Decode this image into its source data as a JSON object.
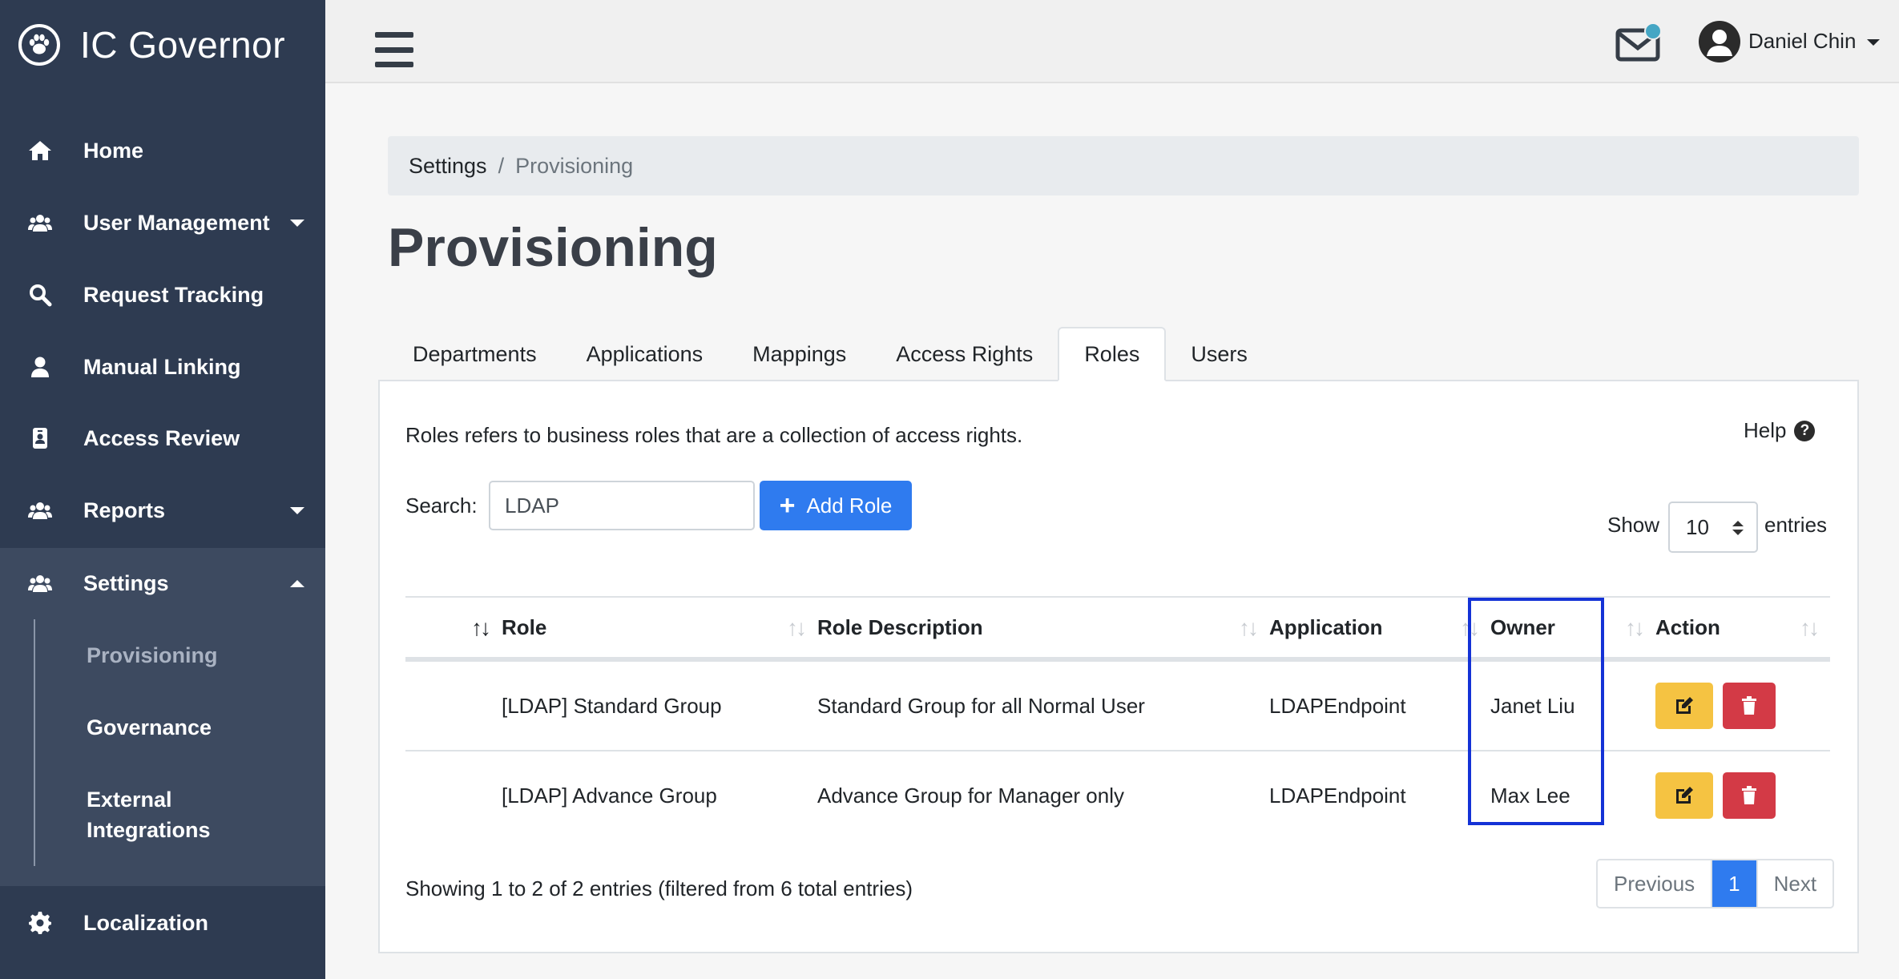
{
  "brand": {
    "name": "IC Governor",
    "logo_icon": "paw-icon"
  },
  "sidebar": {
    "items": [
      {
        "label": "Home",
        "icon": "home-icon"
      },
      {
        "label": "User Management",
        "icon": "users-icon",
        "has_caret": "down"
      },
      {
        "label": "Request Tracking",
        "icon": "search-icon"
      },
      {
        "label": "Manual Linking",
        "icon": "user-icon"
      },
      {
        "label": "Access Review",
        "icon": "id-badge-icon"
      },
      {
        "label": "Reports",
        "icon": "users-icon",
        "has_caret": "down"
      },
      {
        "label": "Settings",
        "icon": "users-icon",
        "has_caret": "up"
      },
      {
        "label": "Localization",
        "icon": "gear-icon"
      }
    ],
    "settings_sub": [
      {
        "label": "Provisioning",
        "active": true
      },
      {
        "label": "Governance"
      },
      {
        "label": "External Integrations"
      }
    ]
  },
  "topbar": {
    "user_name": "Daniel Chin",
    "mail_icon": "envelope-icon",
    "notification_color": "#45a6c4"
  },
  "breadcrumb": {
    "parent": "Settings",
    "separator": "/",
    "current": "Provisioning"
  },
  "page": {
    "title": "Provisioning"
  },
  "tabs": [
    "Departments",
    "Applications",
    "Mappings",
    "Access Rights",
    "Roles",
    "Users"
  ],
  "active_tab": "Roles",
  "panel": {
    "description": "Roles refers to business roles that are a collection of access rights.",
    "help_label": "Help",
    "search_label": "Search:",
    "search_value": "LDAP",
    "add_role_label": "Add Role",
    "show_label": "Show",
    "show_value": "10",
    "entries_label": "entries"
  },
  "table": {
    "columns": [
      "",
      "Role",
      "Role Description",
      "Application",
      "Owner",
      "Action"
    ],
    "rows": [
      {
        "role": "[LDAP] Standard Group",
        "description": "Standard Group for all Normal User",
        "application": "LDAPEndpoint",
        "owner": "Janet Liu"
      },
      {
        "role": "[LDAP] Advance Group",
        "description": "Advance Group for Manager only",
        "application": "LDAPEndpoint",
        "owner": "Max Lee"
      }
    ]
  },
  "footer": {
    "info": "Showing 1 to 2 of 2 entries (filtered from 6 total entries)",
    "prev_label": "Previous",
    "page": "1",
    "next_label": "Next"
  },
  "colors": {
    "sidebar": "#2e3b51",
    "primary": "#2f7bef",
    "warning": "#f5c342",
    "danger": "#d33a46",
    "highlight": "#1432d6"
  }
}
